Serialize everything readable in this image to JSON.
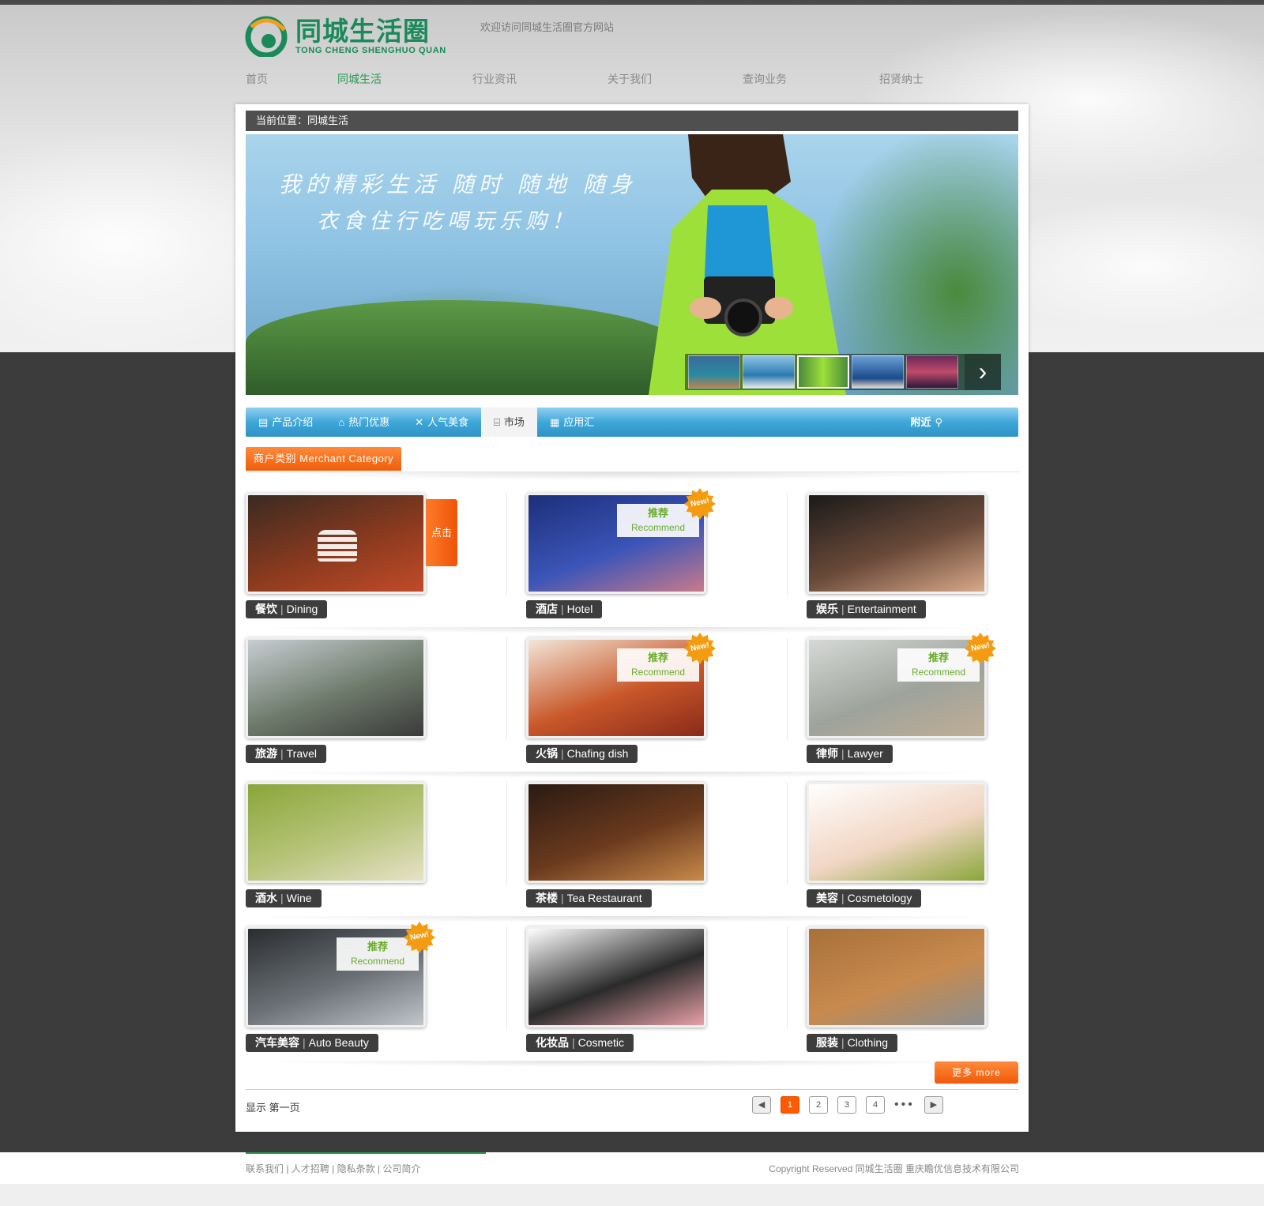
{
  "header": {
    "logo_cn": "同城生活圈",
    "logo_en": "TONG CHENG SHENGHUO QUAN",
    "welcome": "欢迎访问同城生活圈官方网站"
  },
  "nav": [
    {
      "label": "首页",
      "active": false
    },
    {
      "label": "同城生活",
      "active": true
    },
    {
      "label": "行业资讯",
      "active": false
    },
    {
      "label": "关于我们",
      "active": false
    },
    {
      "label": "查询业务",
      "active": false
    },
    {
      "label": "招贤纳士",
      "active": false
    }
  ],
  "breadcrumb": "当前位置：同城生活",
  "banner": {
    "line1": "我的精彩生活 随时 随地 随身",
    "line2": "衣食住行吃喝玩乐购！",
    "thumb_count": 5,
    "active_thumb": 3
  },
  "tabs": [
    {
      "label": "产品介绍",
      "icon": "book-icon",
      "active": false
    },
    {
      "label": "热门优惠",
      "icon": "basket-icon",
      "active": false
    },
    {
      "label": "人气美食",
      "icon": "cutlery-icon",
      "active": false
    },
    {
      "label": "市场",
      "icon": "market-icon",
      "active": true
    },
    {
      "label": "应用汇",
      "icon": "calendar-icon",
      "active": false
    }
  ],
  "nearby": "附近",
  "category_header": "商户类别 Merchant Category",
  "recommend": {
    "cn": "推荐",
    "en": "Recommend",
    "new": "New!"
  },
  "click_label": "点击",
  "categories": [
    {
      "cn": "餐饮",
      "en": "Dining",
      "colors": [
        "#3a2a22",
        "#8a3a1e",
        "#c24a2a"
      ],
      "recommended": false,
      "hover": true
    },
    {
      "cn": "酒店",
      "en": "Hotel",
      "colors": [
        "#1c2f7a",
        "#3b55b8",
        "#c87a8a"
      ],
      "recommended": true,
      "hover": false
    },
    {
      "cn": "娱乐",
      "en": "Entertainment",
      "colors": [
        "#1a1a1a",
        "#6a4a3a",
        "#d9a98a"
      ],
      "recommended": false,
      "hover": false
    },
    {
      "cn": "旅游",
      "en": "Travel",
      "colors": [
        "#c7cdd2",
        "#6d7a6a",
        "#3a3a3a"
      ],
      "recommended": false,
      "hover": false
    },
    {
      "cn": "火锅",
      "en": "Chafing dish",
      "colors": [
        "#f2e6d8",
        "#c9582a",
        "#8a2a1a"
      ],
      "recommended": true,
      "hover": false
    },
    {
      "cn": "律师",
      "en": "Lawyer",
      "colors": [
        "#d6d9d6",
        "#9ea39c",
        "#bfae96"
      ],
      "recommended": true,
      "hover": false
    },
    {
      "cn": "酒水",
      "en": "Wine",
      "colors": [
        "#8aa63a",
        "#b7c47a",
        "#e6e2c8"
      ],
      "recommended": false,
      "hover": false
    },
    {
      "cn": "茶楼",
      "en": "Tea Restaurant",
      "colors": [
        "#2a1a12",
        "#6a3a1e",
        "#c98a4a"
      ],
      "recommended": false,
      "hover": false
    },
    {
      "cn": "美容",
      "en": "Cosmetology",
      "colors": [
        "#ffffff",
        "#f1d6c4",
        "#8aa63a"
      ],
      "recommended": false,
      "hover": false
    },
    {
      "cn": "汽车美容",
      "en": "Auto Beauty",
      "colors": [
        "#2a2d30",
        "#6b7176",
        "#bfc5c9"
      ],
      "recommended": true,
      "hover": false
    },
    {
      "cn": "化妆品",
      "en": "Cosmetic",
      "colors": [
        "#ffffff",
        "#2a2a2a",
        "#e8a0a8"
      ],
      "recommended": false,
      "hover": false
    },
    {
      "cn": "服装",
      "en": "Clothing",
      "colors": [
        "#a8703a",
        "#c88a4e",
        "#8a8f92"
      ],
      "recommended": false,
      "hover": false
    }
  ],
  "more_label": "更多 more",
  "pager": {
    "text": "显示  第一页",
    "pages": [
      "1",
      "2",
      "3",
      "4"
    ],
    "current": "1",
    "prev": "◀",
    "next": "▶",
    "dots": "•••"
  },
  "footer": {
    "links": "联系我们  |  人才招聘  |  隐私条款  |  公司简介",
    "copyright": "Copyright Reserved 同城生活圈    重庆瞻优信息技术有限公司"
  }
}
